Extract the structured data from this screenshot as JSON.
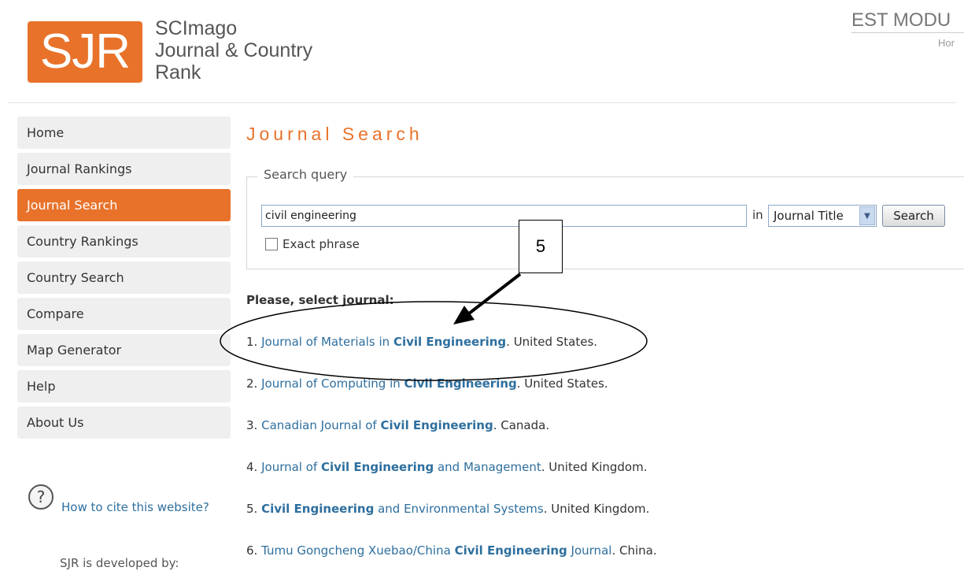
{
  "header": {
    "logo_text": "SJR",
    "title_lines": [
      "SCImago",
      "Journal & Country",
      "Rank"
    ],
    "right_text": "EST MODU",
    "right_sub": "Hor"
  },
  "sidebar": {
    "items": [
      {
        "label": "Home"
      },
      {
        "label": "Journal Rankings"
      },
      {
        "label": "Journal Search"
      },
      {
        "label": "Country Rankings"
      },
      {
        "label": "Country Search"
      },
      {
        "label": "Compare"
      },
      {
        "label": "Map Generator"
      },
      {
        "label": "Help"
      },
      {
        "label": "About Us"
      }
    ],
    "active_index": 2,
    "help_icon": "?",
    "cite_link": "How to cite this website?",
    "developed_by": "SJR is developed by:"
  },
  "main": {
    "title": "Journal Search",
    "search": {
      "legend": "Search query",
      "query": "civil engineering",
      "in_label": "in",
      "field": "Journal Title",
      "button": "Search",
      "exact_label": "Exact phrase"
    },
    "select_prompt": "Please, select journal:",
    "results": [
      {
        "num": "1. ",
        "parts": [
          {
            "t": "Journal of Materials in ",
            "b": false
          },
          {
            "t": "Civil Engineering",
            "b": true
          }
        ],
        "suffix": ". United States."
      },
      {
        "num": "2. ",
        "parts": [
          {
            "t": "Journal of Computing in ",
            "b": false
          },
          {
            "t": "Civil Engineering",
            "b": true
          }
        ],
        "suffix": ". United States."
      },
      {
        "num": "3. ",
        "parts": [
          {
            "t": "Canadian Journal of ",
            "b": false
          },
          {
            "t": "Civil Engineering",
            "b": true
          }
        ],
        "suffix": ". Canada."
      },
      {
        "num": "4. ",
        "parts": [
          {
            "t": "Journal of ",
            "b": false
          },
          {
            "t": "Civil Engineering",
            "b": true
          },
          {
            "t": " and Management",
            "b": false
          }
        ],
        "suffix": ". United Kingdom."
      },
      {
        "num": "5. ",
        "parts": [
          {
            "t": "Civil Engineering",
            "b": true
          },
          {
            "t": " and Environmental Systems",
            "b": false
          }
        ],
        "suffix": ". United Kingdom."
      },
      {
        "num": "6. ",
        "parts": [
          {
            "t": "Tumu Gongcheng Xuebao/China ",
            "b": false
          },
          {
            "t": "Civil Engineering",
            "b": true
          },
          {
            "t": " Journal",
            "b": false
          }
        ],
        "suffix": ". China."
      }
    ]
  },
  "annotation": {
    "callout_number": "5"
  },
  "colors": {
    "accent": "#e8722a",
    "link": "#2e6f9e"
  }
}
